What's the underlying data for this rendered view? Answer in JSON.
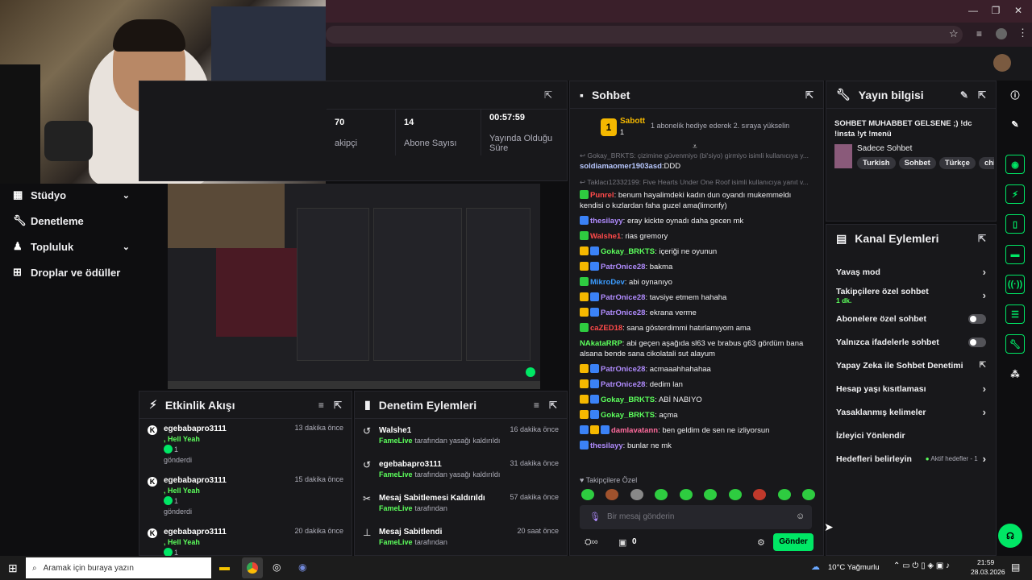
{
  "browser": {
    "window_controls": [
      "—",
      "❐",
      "✕"
    ]
  },
  "sidebar": {
    "items": [
      {
        "label": "Stüdyo",
        "icon": "studio-icon",
        "chevron": true
      },
      {
        "label": "Denetleme",
        "icon": "wrench-icon",
        "chevron": false
      },
      {
        "label": "Topluluk",
        "icon": "community-icon",
        "chevron": true
      },
      {
        "label": "Droplar ve ödüller",
        "icon": "drops-icon",
        "chevron": false
      }
    ]
  },
  "stats": {
    "followers_value": "70",
    "followers_label": "akipçi",
    "subs_value": "14",
    "subs_label": "Abone Sayısı",
    "uptime_value": "00:57:59",
    "uptime_label": "Yayında Olduğu Süre"
  },
  "activity": {
    "title": "Etkinlik Akışı",
    "items": [
      {
        "user": "egebabapro3111",
        "msg": ", Hell Yeah",
        "count": "1",
        "sent": "gönderdi",
        "time": "13 dakika önce"
      },
      {
        "user": "egebabapro3111",
        "msg": ", Hell Yeah",
        "count": "1",
        "sent": "gönderdi",
        "time": "15 dakika önce"
      },
      {
        "user": "egebabapro3111",
        "msg": ", Hell Yeah",
        "count": "1",
        "sent": "",
        "time": "20 dakika önce"
      }
    ]
  },
  "modactions": {
    "title": "Denetim Eylemleri",
    "items": [
      {
        "title": "Walshe1",
        "by": "FameLive",
        "desc": "tarafından yasağı kaldırıldı",
        "time": "16 dakika önce"
      },
      {
        "title": "egebabapro3111",
        "by": "FameLive",
        "desc": "tarafından yasağı kaldırıldı",
        "time": "31 dakika önce"
      },
      {
        "title": "Mesaj Sabitlemesi Kaldırıldı",
        "by": "FameLive",
        "desc": "tarafından",
        "time": "57 dakika önce"
      },
      {
        "title": "Mesaj Sabitlendi",
        "by": "FameLive",
        "desc": "tarafından",
        "time": "20 saat önce"
      }
    ]
  },
  "chat": {
    "title": "Sohbet",
    "pinned_user": "Sabott",
    "pinned_count": "1",
    "pinned_text": "1 abonelik hediye ederek 2. sıraya yükselin",
    "reply_hint_1": "Gokay_BRKTS: çizimine güvenmiyo (bi'siyo) girmiyo isimli kullanıcıya y...",
    "first_user": "soldiamaomer1903asd",
    "first_text": ":DDD",
    "reply_hint_2": "Taklacı12332199: Five Hearts Under One Roof isimli kullanıcıya yanıt v...",
    "messages": [
      {
        "user": "Punrel",
        "color": "#ff4a4a",
        "text": ": benum hayalimdeki kadın dun oyandı mukemmeldı kendisi o kızlardan faha guzel ama(limonfy)",
        "badges": [
          "#2ecc40"
        ]
      },
      {
        "user": "thesilayy",
        "color": "#b18cff",
        "text": ": eray kickte oynadı daha gecen mk",
        "badges": [
          "#3b82f6"
        ]
      },
      {
        "user": "Walshe1",
        "color": "#ff4a4a",
        "text": ": rias gremory",
        "badges": [
          "#2ecc40"
        ]
      },
      {
        "user": "Gokay_BRKTS",
        "color": "#5cff5c",
        "text": ": içeriği ne oyunun",
        "badges": [
          "#f5b800",
          "#3b82f6"
        ]
      },
      {
        "user": "PatrOnice28",
        "color": "#b18cff",
        "text": ": bakma",
        "badges": [
          "#f5b800",
          "#3b82f6"
        ]
      },
      {
        "user": "MikroDev",
        "color": "#3b9cff",
        "text": ": abi oynanıyo",
        "badges": [
          "#2ecc40"
        ]
      },
      {
        "user": "PatrOnice28",
        "color": "#b18cff",
        "text": ": tavsiye etmem hahaha",
        "badges": [
          "#f5b800",
          "#3b82f6"
        ]
      },
      {
        "user": "PatrOnice28",
        "color": "#b18cff",
        "text": ": ekrana verme",
        "badges": [
          "#f5b800",
          "#3b82f6"
        ]
      },
      {
        "user": "caZED18",
        "color": "#ff4a4a",
        "text": ": sana gösterdimmi hatırlamıyom ama",
        "badges": [
          "#2ecc40"
        ]
      },
      {
        "user": "NAkataRRP",
        "color": "#5cff5c",
        "text": ": abi geçen aşağıda sl63 ve brabus g63 gördüm bana alsana bende sana cikolatali sut alayum",
        "badges": []
      },
      {
        "user": "PatrOnice28",
        "color": "#b18cff",
        "text": ": acmaaahhahahaa",
        "badges": [
          "#f5b800",
          "#3b82f6"
        ]
      },
      {
        "user": "PatrOnice28",
        "color": "#b18cff",
        "text": ": dedim lan",
        "badges": [
          "#f5b800",
          "#3b82f6"
        ]
      },
      {
        "user": "Gokay_BRKTS",
        "color": "#5cff5c",
        "text": ": ABİ NABIYO",
        "badges": [
          "#f5b800",
          "#3b82f6"
        ]
      },
      {
        "user": "Gokay_BRKTS",
        "color": "#5cff5c",
        "text": ": açma",
        "badges": [
          "#f5b800",
          "#3b82f6"
        ]
      },
      {
        "user": "damlavatann",
        "color": "#ff6b9d",
        "text": ": ben geldim de sen ne izliyorsun",
        "badges": [
          "#3b82f6",
          "#f5b800",
          "#3b82f6"
        ]
      },
      {
        "user": "thesilayy",
        "color": "#b18cff",
        "text": ": bunlar ne mk",
        "badges": [
          "#3b82f6"
        ]
      }
    ],
    "followers_only": "♥ Takipçilere Özel",
    "placeholder": "Bir mesaj gönderin",
    "send_label": "Gönder",
    "points": "0",
    "emote_colors": [
      "#2ecc40",
      "#a0522d",
      "#888",
      "#2ecc40",
      "#2ecc40",
      "#2ecc40",
      "#2ecc40",
      "#c0392b",
      "#2ecc40",
      "#2ecc40"
    ]
  },
  "streaminfo": {
    "title": "Yayın bilgisi",
    "stream_title": "SOHBET MUHABBET GELSENE ;) !dc !insta !yt !menü",
    "category": "Sadece Sohbet",
    "tags": [
      "Turkish",
      "Sohbet",
      "Türkçe",
      "chi"
    ]
  },
  "channel": {
    "title": "Kanal Eylemleri",
    "slow": "Yavaş mod",
    "followers": "Takipçilere özel sohbet",
    "followers_sub": "1 dk.",
    "subs": "Abonelere özel sohbet",
    "emotes": "Yalnızca ifadelerle sohbet",
    "ai": "Yapay Zeka ile Sohbet Denetimi",
    "age": "Hesap yaşı kısıtlaması",
    "banned": "Yasaklanmış kelimeler",
    "viewer": "İzleyici Yönlendir",
    "goals": "Hedefleri belirleyin",
    "goals_sub": "Aktif hedefler - 1"
  },
  "taskbar": {
    "search": "Aramak için buraya yazın",
    "weather": "10°C  Yağmurlu",
    "time": "21:59",
    "date": "28.03.2026"
  }
}
